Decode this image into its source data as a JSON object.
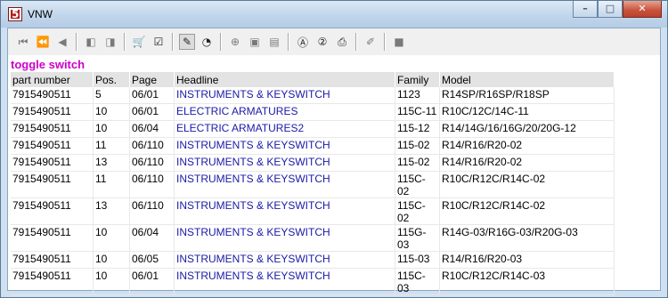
{
  "window": {
    "title": "VNW",
    "app_icon": "5",
    "minimize": "–",
    "maximize": "□",
    "close": "✕"
  },
  "toolbar": {
    "icons": [
      "first-icon",
      "prev-fast-icon",
      "prev-icon",
      "bookmark-back-icon",
      "bookmark-forward-icon",
      "cart-icon",
      "checklist-icon",
      "tool-icon",
      "pie-icon",
      "zoom-icon",
      "page-icon",
      "page-alt-icon",
      "info-a-icon",
      "info-2-icon",
      "print-icon",
      "note-icon",
      "stop-icon"
    ]
  },
  "section_title": "toggle switch",
  "table": {
    "headers": [
      "part number",
      "Pos.",
      "Page",
      "Headline",
      "Family",
      "Model"
    ],
    "rows": [
      [
        "7915490511",
        "5",
        "06/01",
        "INSTRUMENTS & KEYSWITCH",
        "1123",
        "R14SP/R16SP/R18SP"
      ],
      [
        "7915490511",
        "10",
        "06/01",
        "ELECTRIC ARMATURES",
        "115C-11",
        "R10C/12C/14C-11"
      ],
      [
        "7915490511",
        "10",
        "06/04",
        "ELECTRIC ARMATURES2",
        "115-12",
        "R14/14G/16/16G/20/20G-12"
      ],
      [
        "7915490511",
        "11",
        "06/110",
        "INSTRUMENTS & KEYSWITCH",
        "115-02",
        "R14/R16/R20-02"
      ],
      [
        "7915490511",
        "13",
        "06/110",
        "INSTRUMENTS & KEYSWITCH",
        "115-02",
        "R14/R16/R20-02"
      ],
      [
        "7915490511",
        "11",
        "06/110",
        "INSTRUMENTS & KEYSWITCH",
        "115C-02",
        "R10C/R12C/R14C-02"
      ],
      [
        "7915490511",
        "13",
        "06/110",
        "INSTRUMENTS & KEYSWITCH",
        "115C-02",
        "R10C/R12C/R14C-02"
      ],
      [
        "7915490511",
        "10",
        "06/04",
        "INSTRUMENTS & KEYSWITCH",
        "115G-03",
        "R14G-03/R16G-03/R20G-03"
      ],
      [
        "7915490511",
        "10",
        "06/05",
        "INSTRUMENTS & KEYSWITCH",
        "115-03",
        "R14/R16/R20-03"
      ],
      [
        "7915490511",
        "10",
        "06/01",
        "INSTRUMENTS & KEYSWITCH",
        "115C-03",
        "R10C/R12C/R14C-03"
      ]
    ]
  },
  "colors": {
    "section_title": "#cc00cc",
    "link": "#1a1aa6",
    "header_bg": "#e3e3e3"
  }
}
